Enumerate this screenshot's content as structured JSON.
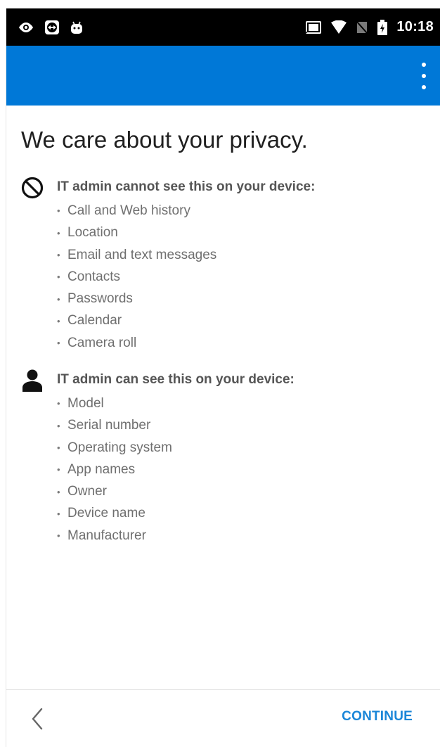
{
  "status_bar": {
    "time": "10:18",
    "icons_left": [
      "eye-icon",
      "teamviewer-icon",
      "android-icon"
    ],
    "icons_right": [
      "cast-icon",
      "wifi-icon",
      "no-sim-icon",
      "battery-icon"
    ]
  },
  "app_bar": {
    "color": "#0078d7",
    "overflow_icon": "more-vert-icon"
  },
  "page": {
    "title": "We care about your privacy."
  },
  "cannot_see": {
    "icon": "block-icon",
    "heading": "IT admin cannot see this on your device:",
    "items": [
      "Call and Web history",
      "Location",
      "Email and text messages",
      "Contacts",
      "Passwords",
      "Calendar",
      "Camera roll"
    ]
  },
  "can_see": {
    "icon": "person-icon",
    "heading": "IT admin can see this on your device:",
    "items": [
      "Model",
      "Serial number",
      "Operating system",
      "App names",
      "Owner",
      "Device name",
      "Manufacturer"
    ]
  },
  "footer": {
    "back_icon": "chevron-left-icon",
    "continue_label": "CONTINUE",
    "accent": "#1a86d8"
  }
}
